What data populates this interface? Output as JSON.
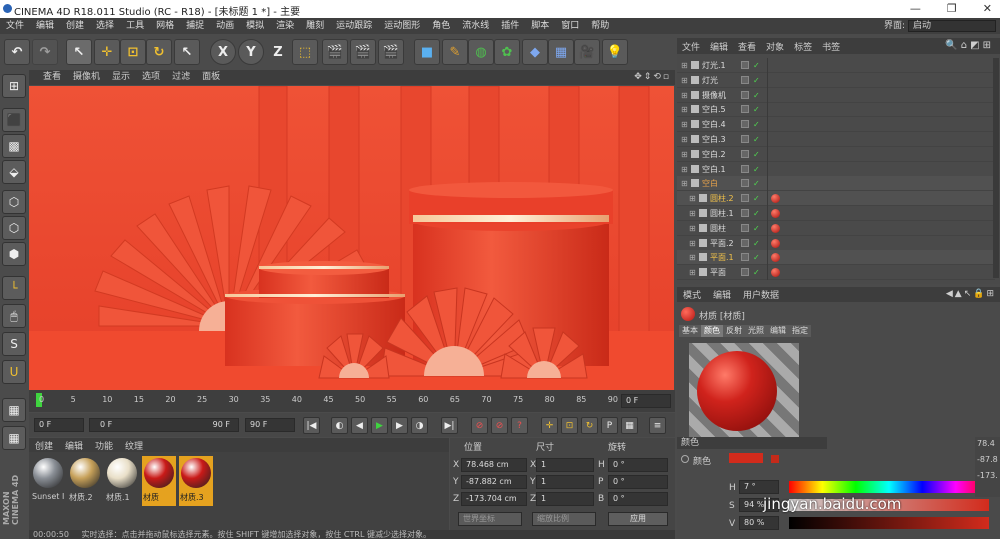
{
  "window": {
    "title": "CINEMA 4D R18.011 Studio (RC - R18) - [未标题 1 *] - 主要",
    "min": "—",
    "max": "❐",
    "close": "✕"
  },
  "menu": [
    "文件",
    "编辑",
    "创建",
    "选择",
    "工具",
    "网格",
    "捕捉",
    "动画",
    "模拟",
    "渲染",
    "雕刻",
    "运动跟踪",
    "运动图形",
    "角色",
    "流水线",
    "插件",
    "脚本",
    "窗口",
    "帮助"
  ],
  "interface": {
    "label": "界面:",
    "value": "启动"
  },
  "viewport_menu": [
    "查看",
    "摄像机",
    "显示",
    "选项",
    "过滤",
    "面板"
  ],
  "timeline": {
    "ticks": [
      "0",
      "5",
      "10",
      "15",
      "20",
      "25",
      "30",
      "35",
      "40",
      "45",
      "50",
      "55",
      "60",
      "65",
      "70",
      "75",
      "80",
      "85",
      "90"
    ],
    "frame_end": "0 F"
  },
  "controls": {
    "start": "0 F",
    "range_start": "0 F",
    "range_end": "90 F",
    "end": "90 F"
  },
  "material_menu": [
    "创建",
    "编辑",
    "功能",
    "纹理"
  ],
  "materials": [
    {
      "name": "Sunset I",
      "color": "#8a8f96"
    },
    {
      "name": "材质.2",
      "color": "#c7a15a"
    },
    {
      "name": "材质.1",
      "color": "#e9dfc8"
    },
    {
      "name": "材质",
      "color": "#c91a18"
    },
    {
      "name": "材质.3",
      "color": "#c91a18"
    }
  ],
  "coords": {
    "headers": [
      "位置",
      "尺寸",
      "旋转"
    ],
    "rows": [
      {
        "axis": "X",
        "pos": "78.468 cm",
        "size": "1",
        "rlabel": "H",
        "rot": "0 °"
      },
      {
        "axis": "Y",
        "pos": "-87.882 cm",
        "size": "1",
        "rlabel": "P",
        "rot": "0 °"
      },
      {
        "axis": "Z",
        "pos": "-173.704 cm",
        "size": "1",
        "rlabel": "B",
        "rot": "0 °"
      }
    ],
    "mode1": "世界坐标",
    "mode2": "缩放比例",
    "apply": "应用"
  },
  "status": {
    "time": "00:00:50",
    "text": "实时选择：点击并拖动鼠标选择元素。按住 SHIFT 键增加选择对象，按住 CTRL 键减少选择对象。"
  },
  "object_menu": [
    "文件",
    "编辑",
    "查看",
    "对象",
    "标签",
    "书签"
  ],
  "objects": [
    {
      "name": "灯光.1",
      "indent": 0,
      "color": "#ddd"
    },
    {
      "name": "灯光",
      "indent": 0,
      "color": "#ddd"
    },
    {
      "name": "摄像机",
      "indent": 0,
      "color": "#ddd"
    },
    {
      "name": "空白.5",
      "indent": 0,
      "color": "#ddd"
    },
    {
      "name": "空白.4",
      "indent": 0,
      "color": "#ddd"
    },
    {
      "name": "空白.3",
      "indent": 0,
      "color": "#ddd"
    },
    {
      "name": "空白.2",
      "indent": 0,
      "color": "#ddd"
    },
    {
      "name": "空白.1",
      "indent": 0,
      "color": "#ddd"
    },
    {
      "name": "空白",
      "indent": 0,
      "color": "#e9a34a"
    },
    {
      "name": "圆柱.2",
      "indent": 1,
      "color": "#f2c24a"
    },
    {
      "name": "圆柱.1",
      "indent": 1,
      "color": "#ddd"
    },
    {
      "name": "圆柱",
      "indent": 1,
      "color": "#ddd"
    },
    {
      "name": "平面.2",
      "indent": 1,
      "color": "#ddd"
    },
    {
      "name": "平面.1",
      "indent": 1,
      "color": "#f2c24a"
    },
    {
      "name": "平面",
      "indent": 1,
      "color": "#ddd"
    }
  ],
  "attr_menu": [
    "模式",
    "编辑",
    "用户数据"
  ],
  "attr_title": "材质 [材质]",
  "attr_tabs": [
    "基本",
    "颜色",
    "反射",
    "光照",
    "编辑",
    "指定"
  ],
  "color_section": {
    "title": "颜色",
    "label": "颜色",
    "swatch": "#d22b1c",
    "h_label": "H",
    "h_val": "7 °",
    "s_label": "S",
    "s_val": "94 %",
    "v_label": "V",
    "v_val": "80 %"
  },
  "side_values": [
    "78.4",
    "-87.8",
    "-173."
  ],
  "watermark": "jingyan.baidu.com"
}
